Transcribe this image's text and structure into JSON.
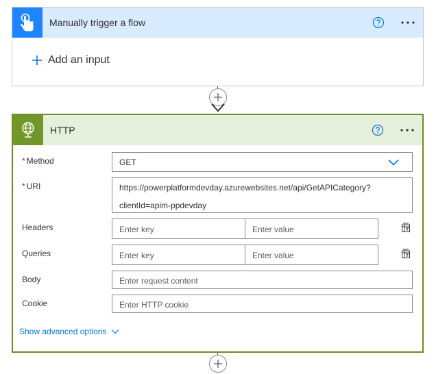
{
  "trigger": {
    "title": "Manually trigger a flow",
    "add_input_label": "Add an input",
    "accent": "#1f85ff",
    "header_bg": "#d9ebff"
  },
  "http": {
    "title": "HTTP",
    "accent": "#709727",
    "header_bg": "#e6eedc",
    "method": {
      "label": "Method",
      "value": "GET"
    },
    "uri": {
      "label": "URI",
      "line1": "https://powerplatformdevday.azurewebsites.net/api/GetAPICategory?",
      "line2": "clientId=apim-ppdevday"
    },
    "headers": {
      "label": "Headers",
      "key_placeholder": "Enter key",
      "value_placeholder": "Enter value"
    },
    "queries": {
      "label": "Queries",
      "key_placeholder": "Enter key",
      "value_placeholder": "Enter value"
    },
    "body": {
      "label": "Body",
      "placeholder": "Enter request content"
    },
    "cookie": {
      "label": "Cookie",
      "placeholder": "Enter HTTP cookie"
    },
    "advanced_label": "Show advanced options"
  },
  "required_marker": "*",
  "icons": [
    "touch-icon",
    "help-icon",
    "more-icon",
    "plus-icon",
    "globe-icon",
    "chevron-down-icon",
    "switch-to-text-icon",
    "add-step-icon",
    "arrow-down-icon"
  ]
}
